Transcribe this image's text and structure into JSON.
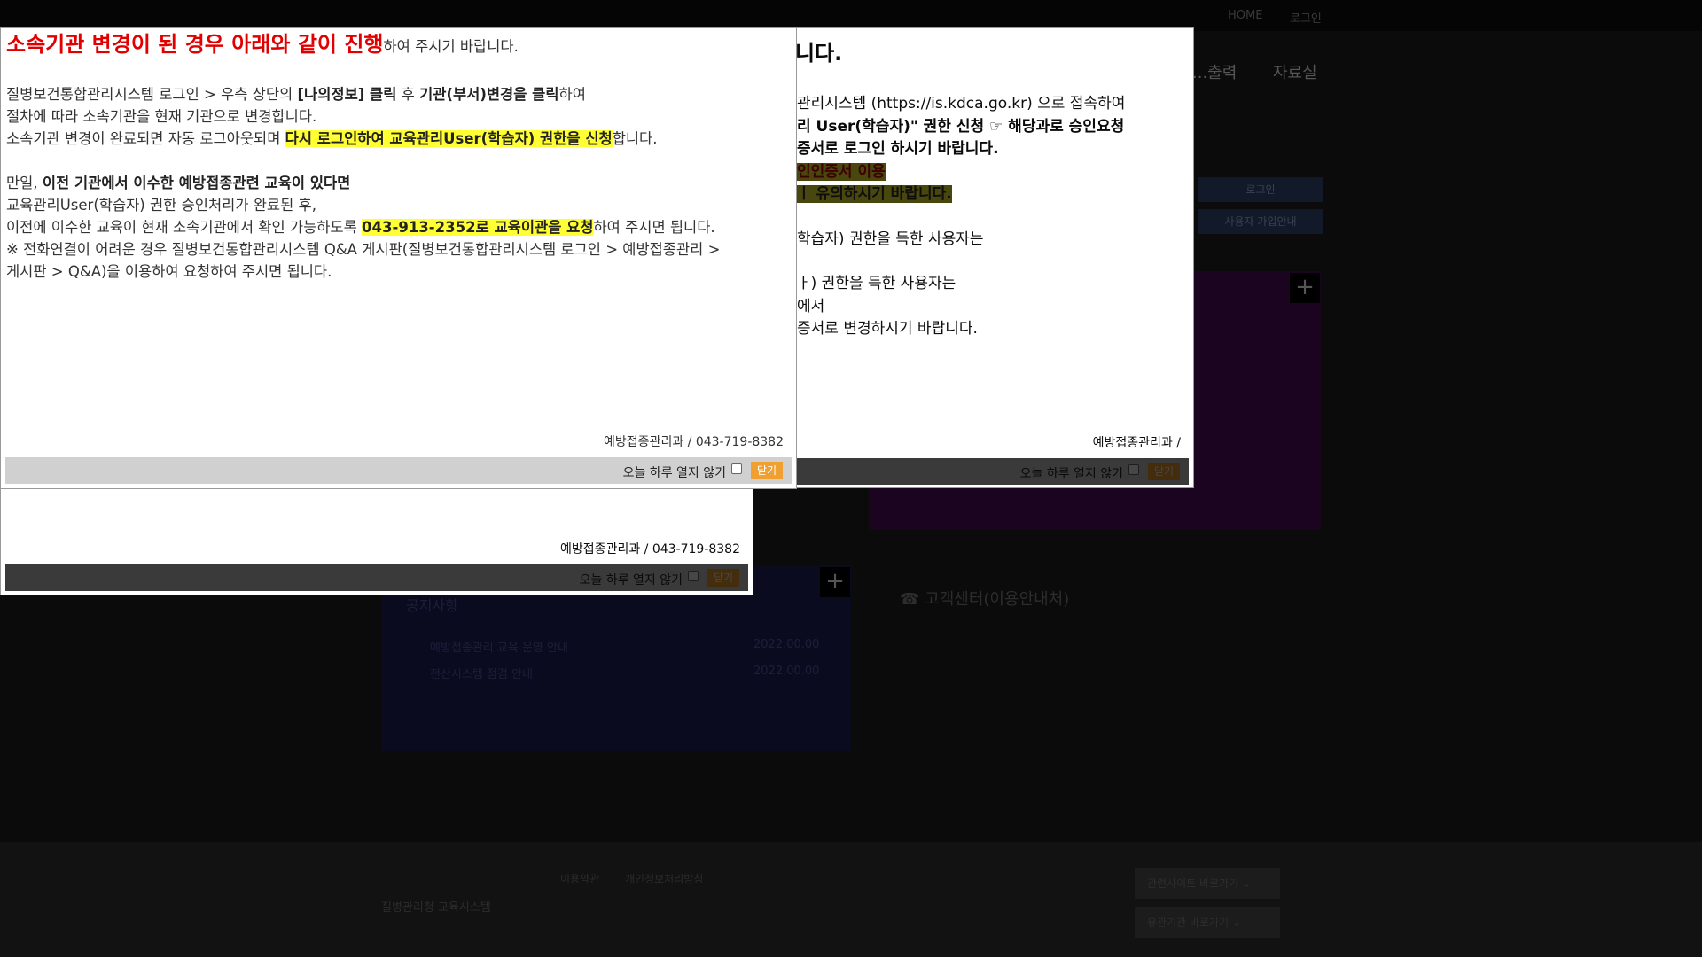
{
  "background": {
    "top_links": [
      "HOME",
      "로그인"
    ],
    "nav": [
      "...출력",
      "자료실"
    ],
    "buttons": [
      "로그인",
      "사용자 가입안내"
    ],
    "notice_title": "공지사항",
    "notice_items": [
      {
        "title": "예방접종관리 교육 운영 안내",
        "date": "2022.00.00"
      },
      {
        "title": "전산시스템 점검 안내",
        "date": "2022.00.00"
      }
    ],
    "cs_title": "고객센터(이용안내처)",
    "footer_links": [
      "이용약관",
      "개인정보처리방침"
    ],
    "footer_logo": "질병관리청 교육시스템",
    "footer_selects": [
      "관련사이트 바로가기",
      "유관기관 바로가기"
    ]
  },
  "popup_back": {
    "title_tail": "니다.",
    "lines": [
      "관리시스템 (https://is.kdca.go.kr) 으로 접속하여",
      "리 User(학습자)\" 권한 신청 ☞ 해당과로 승인요청",
      "증서로 로그인 하시기 바랍니다.",
      "인인증서 이용",
      "ㅣ 유의하시기 바랍니다.",
      "학습자) 권한을 득한 사용자는",
      "ㅏ) 권한을 득한 사용자는",
      "에서",
      "증서로 변경하시기 바랍니다."
    ],
    "sign": "예방접종관리과 /",
    "checkbox_label": "오늘 하루 열지 않기",
    "close_label": "닫기"
  },
  "popup_middle": {
    "sign": "예방접종관리과 / 043-719-8382",
    "checkbox_label": "오늘 하루 열지 않기",
    "close_label": "닫기"
  },
  "popup_front": {
    "title_red": "소속기관 변경이 된 경우 아래와 같이 진행",
    "title_rest": "하여 주시기 바랍니다.",
    "p1_a": "질병보건통합관리시스템 로그인 > 우측 상단의 ",
    "p1_b": "[나의정보] 클릭",
    "p1_c": " 후 ",
    "p1_d": "기관(부서)변경을 클릭",
    "p1_e": "하여",
    "p2": "절차에 따라 소속기관을 현재 기관으로 변경합니다.",
    "p3_a": "소속기관 변경이 완료되면 자동 로그아웃되며 ",
    "p3_b": "다시 로그인하여 교육관리User(학습자) 권한을 신청",
    "p3_c": "합니다.",
    "p4_a": "만일, ",
    "p4_b": "이전 기관에서 이수한 예방접종관련 교육이 있다면",
    "p5": "교육관리User(학습자) 권한 승인처리가 완료된 후,",
    "p6_a": "이전에 이수한 교육이 현재 소속기관에서 확인 가능하도록 ",
    "p6_b": "043-913-2352로 교육이관을 요청",
    "p6_c": "하여 주시면 됩니다.",
    "p7": "※ 전화연결이 어려운 경우 질병보건통합관리시스템 Q&A 게시판(질병보건통합관리시스템 로그인 > 예방접종관리 >",
    "p8": "게시판 > Q&A)을 이용하여 요청하여 주시면 됩니다.",
    "sign": "예방접종관리과 / 043-719-8382",
    "checkbox_label": "오늘 하루 열지 않기",
    "close_label": "닫기"
  }
}
